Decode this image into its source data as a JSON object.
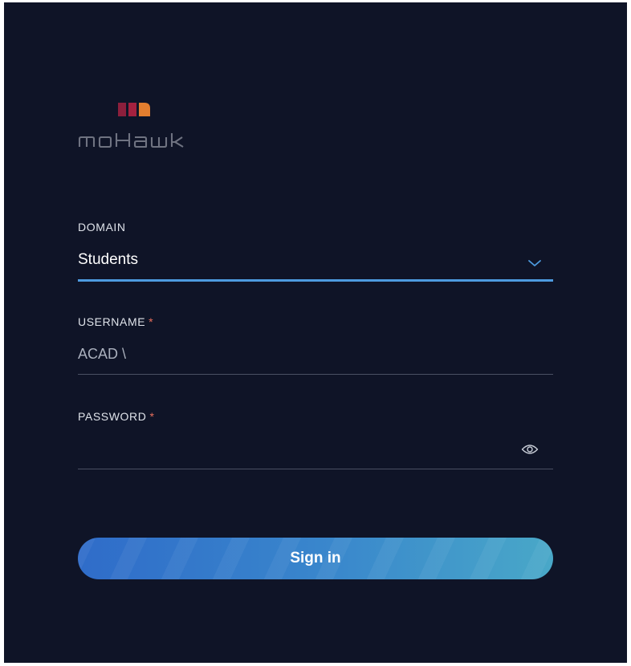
{
  "logo": {
    "name": "MOHAWK",
    "colors": {
      "bar1": "#8c1f3c",
      "bar2": "#a5213f",
      "bar3": "#e37e2f",
      "text": "#6f7381"
    }
  },
  "form": {
    "domain": {
      "label": "DOMAIN",
      "value": "Students",
      "icon": "chevron-down-icon"
    },
    "username": {
      "label": "USERNAME",
      "required_mark": "*",
      "prefix": "ACAD \\"
    },
    "password": {
      "label": "PASSWORD",
      "required_mark": "*",
      "value": "",
      "icon": "eye-icon"
    },
    "submit_label": "Sign in"
  },
  "colors": {
    "background": "#0f1427",
    "accent": "#4d9be0",
    "required": "#e76e5c",
    "button_start": "#2f6cc9",
    "button_end": "#49a8c8"
  }
}
